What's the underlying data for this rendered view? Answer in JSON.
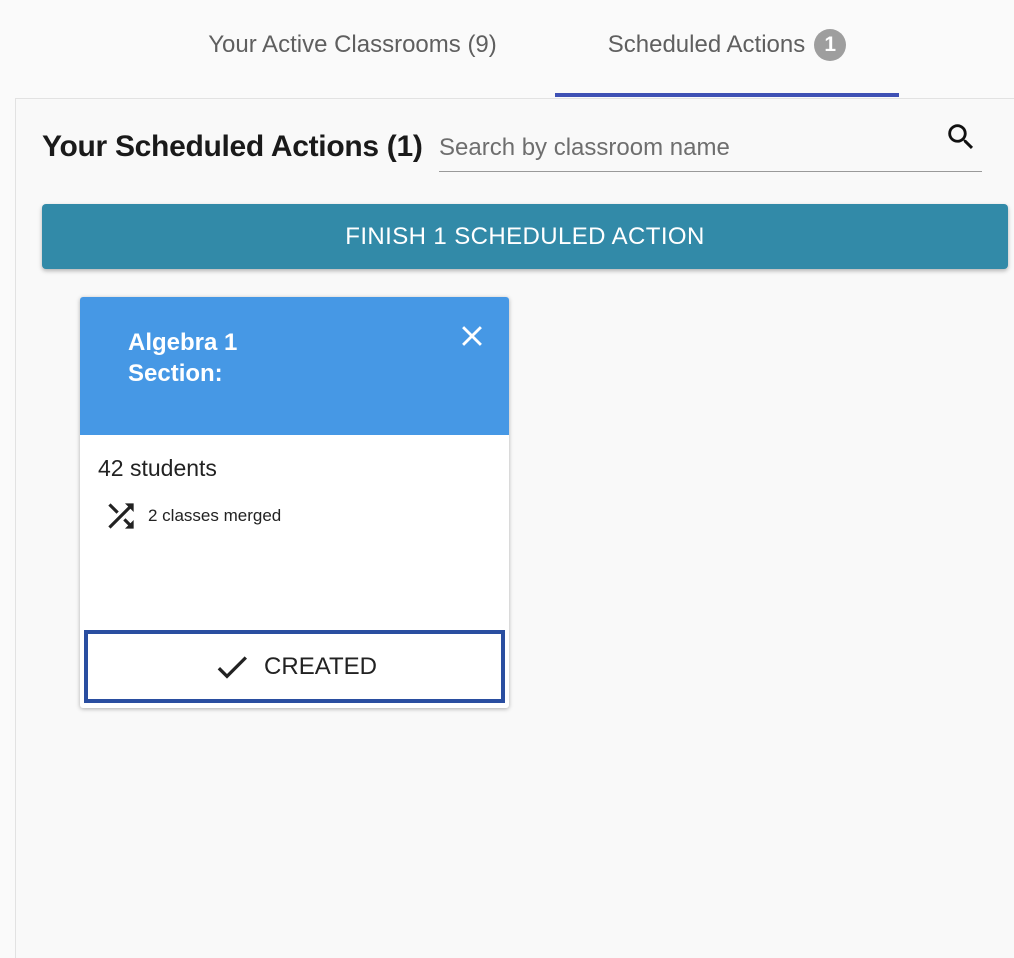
{
  "tabs": [
    {
      "label": "Your Active Classrooms (9)"
    },
    {
      "label": "Scheduled Actions",
      "badge": "1"
    }
  ],
  "section": {
    "title": "Your Scheduled Actions (1)"
  },
  "search": {
    "placeholder": "Search by classroom name",
    "value": ""
  },
  "finish_button": {
    "label": "FINISH 1 SCHEDULED ACTION"
  },
  "card": {
    "title_line1": "Algebra 1",
    "title_line2": "Section:",
    "students": "42 students",
    "merge_info": "2 classes merged",
    "status_label": "CREATED"
  },
  "icons": {
    "search": "search-icon",
    "close": "close-icon",
    "merge": "shuffle-icon",
    "check": "check-icon"
  },
  "colors": {
    "tab_indicator": "#3f51b5",
    "finish_button": "#328aa8",
    "card_header": "#4698e5",
    "created_border": "#2a4ea0",
    "badge": "#9e9e9e"
  }
}
